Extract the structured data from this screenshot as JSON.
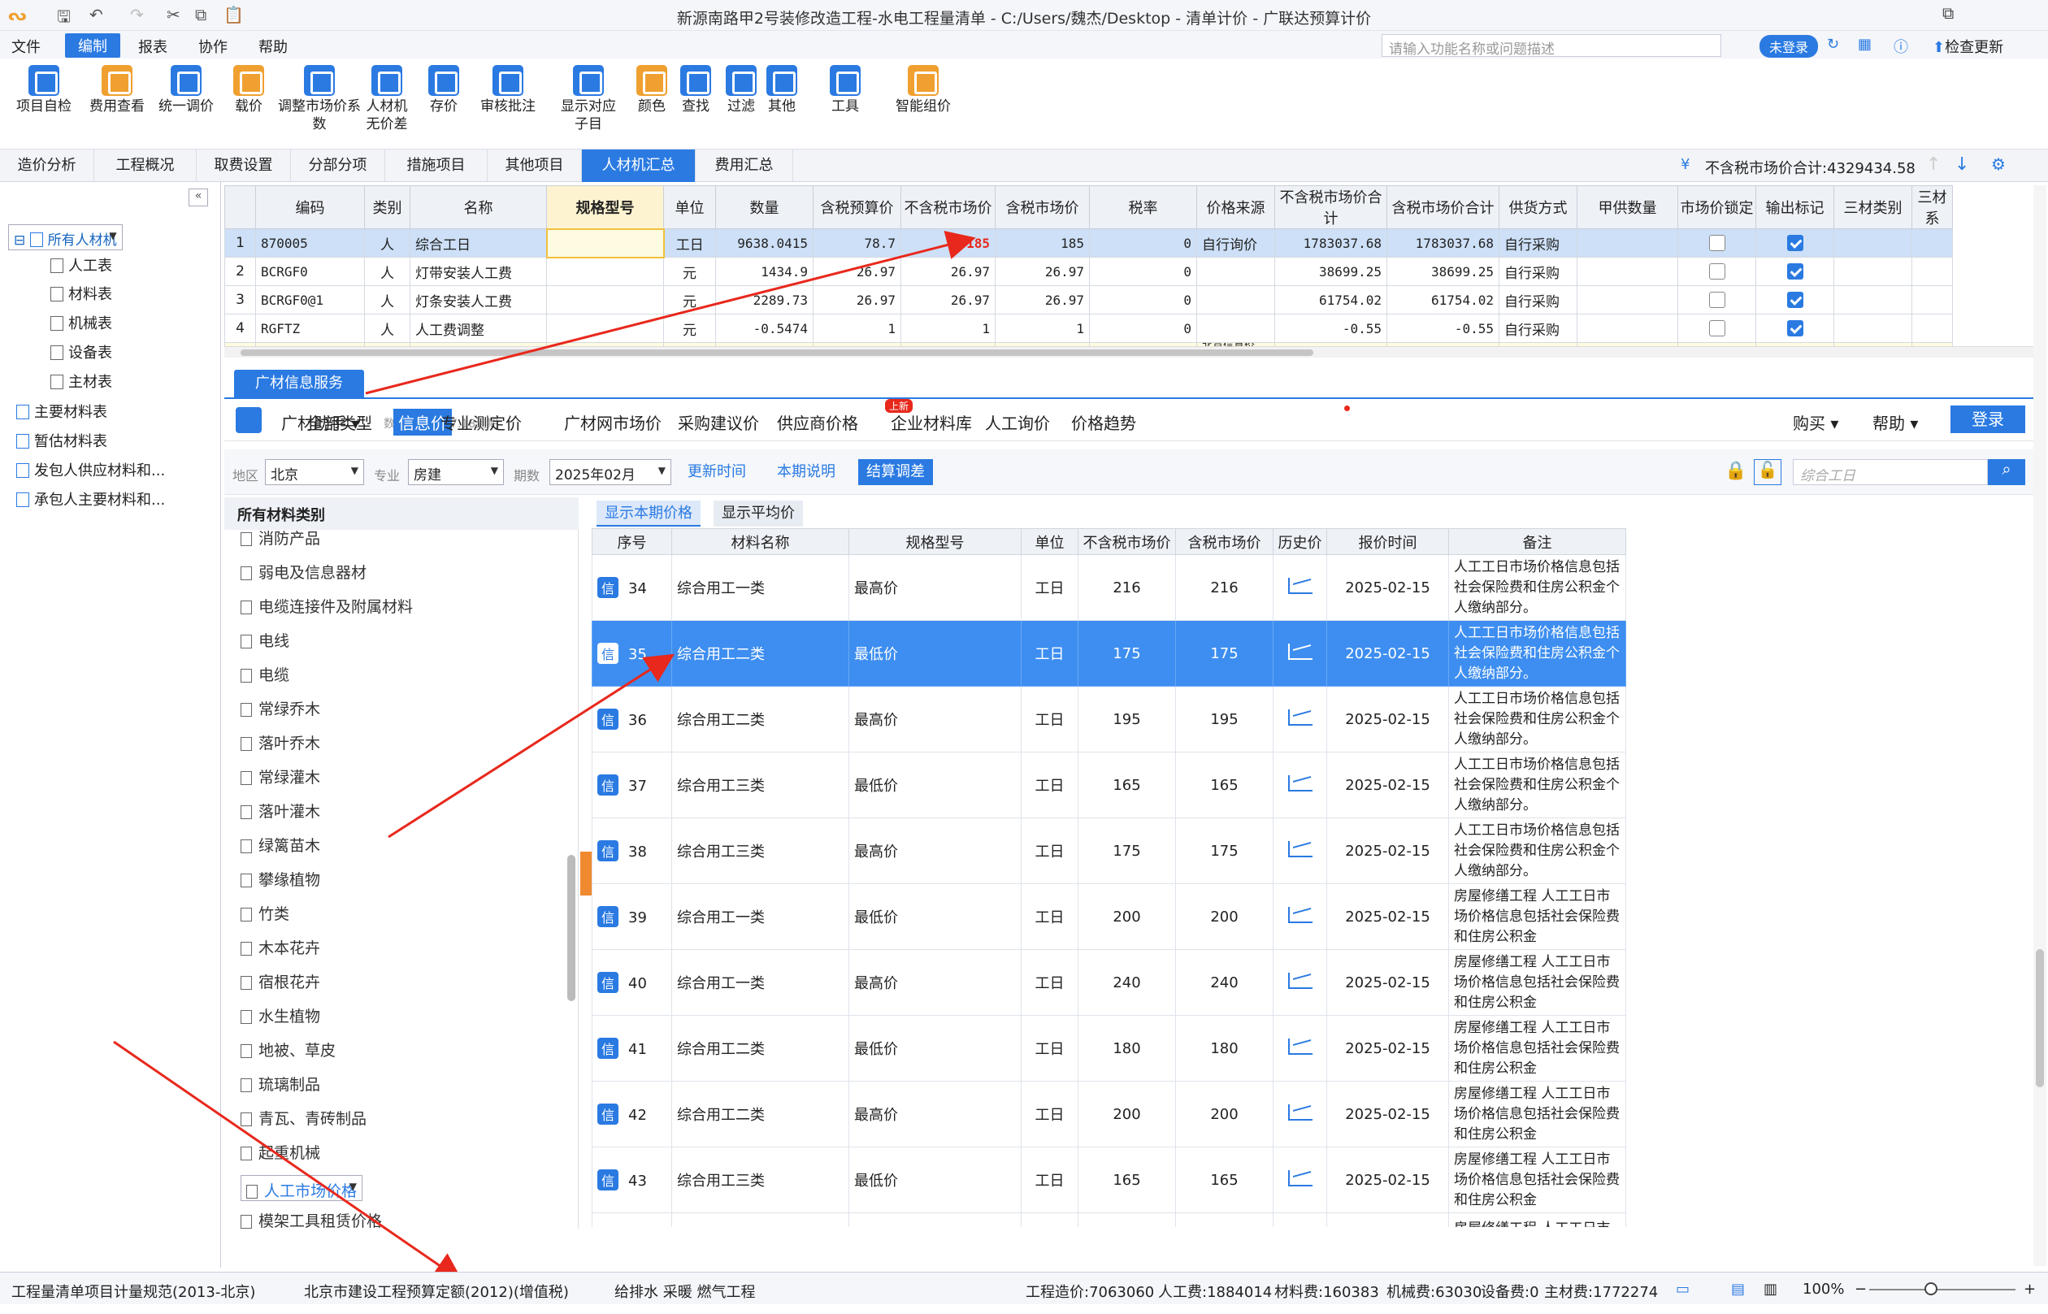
{
  "app": {
    "title": "新源南路甲2号装修改造工程-水电工程量清单 - C:/Users/魏杰/Desktop - 清单计价 - 广联达预算计价"
  },
  "menubar": {
    "items": [
      "文件",
      "编制",
      "报表",
      "协作",
      "帮助"
    ],
    "active": "编制",
    "search_placeholder": "请输入功能名称或问题描述",
    "login": "未登录",
    "update": "检查更新"
  },
  "ribbon": [
    {
      "label": "项目自检",
      "color": "#2a7ae2"
    },
    {
      "label": "费用查看",
      "color": "#f0a030"
    },
    {
      "label": "统一调价",
      "color": "#2a7ae2"
    },
    {
      "label": "载价",
      "color": "#f0a030"
    },
    {
      "label": "调整市场价系数",
      "color": "#2a7ae2"
    },
    {
      "label": "人材机无价差",
      "color": "#2a7ae2"
    },
    {
      "label": "存价",
      "color": "#2a7ae2"
    },
    {
      "label": "审核批注",
      "color": "#2a7ae2"
    },
    {
      "label": "显示对应子目",
      "color": "#2a7ae2"
    },
    {
      "label": "颜色",
      "color": "#f0a030"
    },
    {
      "label": "查找",
      "color": "#2a7ae2"
    },
    {
      "label": "过滤",
      "color": "#2a7ae2"
    },
    {
      "label": "其他",
      "color": "#2a7ae2"
    },
    {
      "label": "工具",
      "color": "#2a7ae2"
    },
    {
      "label": "智能组价",
      "color": "#f0a030"
    }
  ],
  "tabs": [
    "造价分析",
    "工程概况",
    "取费设置",
    "分部分项",
    "措施项目",
    "其他项目",
    "人材机汇总",
    "费用汇总"
  ],
  "active_tab": "人材机汇总",
  "total_label": "不含税市场价合计:4329434.58",
  "tree": [
    {
      "label": "所有人材机",
      "level": 0,
      "selected": true
    },
    {
      "label": "人工表",
      "level": 2
    },
    {
      "label": "材料表",
      "level": 2
    },
    {
      "label": "机械表",
      "level": 2
    },
    {
      "label": "设备表",
      "level": 2
    },
    {
      "label": "主材表",
      "level": 2
    },
    {
      "label": "主要材料表",
      "level": 0
    },
    {
      "label": "暂估材料表",
      "level": 0
    },
    {
      "label": "发包人供应材料和...",
      "level": 0
    },
    {
      "label": "承包人主要材料和...",
      "level": 0
    }
  ],
  "grid": {
    "columns": [
      "",
      "编码",
      "类别",
      "名称",
      "规格型号",
      "单位",
      "数量",
      "含税预算价",
      "不含税市场价",
      "含税市场价",
      "税率",
      "价格来源",
      "不含税市场价合计",
      "含税市场价合计",
      "供货方式",
      "甲供数量",
      "市场价锁定",
      "输出标记",
      "三材类别",
      "三材系"
    ],
    "rows": [
      [
        "1",
        "870005",
        "人",
        "综合工日",
        "",
        "工日",
        "9638.0415",
        "78.7",
        "185",
        "185",
        "0",
        "自行询价",
        "1783037.68",
        "1783037.68",
        "自行采购",
        "",
        false,
        true,
        "",
        ""
      ],
      [
        "2",
        "BCRGF0",
        "人",
        "灯带安装人工费",
        "",
        "元",
        "1434.9",
        "26.97",
        "26.97",
        "26.97",
        "0",
        "",
        "38699.25",
        "38699.25",
        "自行采购",
        "",
        false,
        true,
        "",
        ""
      ],
      [
        "3",
        "BCRGF0@1",
        "人",
        "灯条安装人工费",
        "",
        "元",
        "2289.73",
        "26.97",
        "26.97",
        "26.97",
        "0",
        "",
        "61754.02",
        "61754.02",
        "自行采购",
        "",
        false,
        true,
        "",
        ""
      ],
      [
        "4",
        "RGFTZ",
        "人",
        "人工费调整",
        "",
        "元",
        "-0.5474",
        "1",
        "1",
        "1",
        "0",
        "",
        "-0.55",
        "-0.55",
        "自行采购",
        "",
        false,
        true,
        "",
        ""
      ]
    ],
    "partial_row_text": "北京信息价"
  },
  "gc": {
    "tab": "广材信息服务",
    "assistant": "广材助手",
    "version": "数据包2044.7.18到期",
    "nav": [
      "全部类型",
      "信息价",
      "专业测定价",
      "广材网市场价",
      "采购建议价",
      "供应商价格",
      "企业材料库",
      "人工询价",
      "价格趋势"
    ],
    "nav_active": "信息价",
    "new_badge": "上新",
    "buy": "购买",
    "help": "帮助",
    "login": "登录",
    "filters": {
      "region_label": "地区",
      "region": "北京",
      "major_label": "专业",
      "major": "房建",
      "period_label": "期数",
      "period": "2025年02月"
    },
    "buttons": [
      "更新时间",
      "本期说明",
      "结算调差"
    ],
    "search_placeholder": "综合工日"
  },
  "categories": {
    "header": "所有材料类别",
    "items": [
      "消防产品",
      "弱电及信息器材",
      "电缆连接件及附属材料",
      "电线",
      "电缆",
      "常绿乔木",
      "落叶乔木",
      "常绿灌木",
      "落叶灌木",
      "绿篱苗木",
      "攀缘植物",
      "竹类",
      "木本花卉",
      "宿根花卉",
      "水生植物",
      "地被、草皮",
      "琉璃制品",
      "青瓦、青砖制品",
      "起重机械",
      "人工市场价格",
      "模架工具租赁价格"
    ],
    "selected": "人工市场价格"
  },
  "price": {
    "tabs": [
      "显示本期价格",
      "显示平均价"
    ],
    "columns": [
      "序号",
      "材料名称",
      "规格型号",
      "单位",
      "不含税市场价",
      "含税市场价",
      "历史价",
      "报价时间",
      "备注"
    ],
    "tag": "信",
    "rows": [
      {
        "no": "34",
        "name": "综合用工一类",
        "spec": "最高价",
        "unit": "工日",
        "ex": "216",
        "inc": "216",
        "date": "2025-02-15",
        "note": "人工工日市场价格信息包括社会保险费和住房公积金个人缴纳部分。"
      },
      {
        "no": "35",
        "name": "综合用工二类",
        "spec": "最低价",
        "unit": "工日",
        "ex": "175",
        "inc": "175",
        "date": "2025-02-15",
        "note": "人工工日市场价格信息包括社会保险费和住房公积金个人缴纳部分。",
        "hl": true
      },
      {
        "no": "36",
        "name": "综合用工二类",
        "spec": "最高价",
        "unit": "工日",
        "ex": "195",
        "inc": "195",
        "date": "2025-02-15",
        "note": "人工工日市场价格信息包括社会保险费和住房公积金个人缴纳部分。"
      },
      {
        "no": "37",
        "name": "综合用工三类",
        "spec": "最低价",
        "unit": "工日",
        "ex": "165",
        "inc": "165",
        "date": "2025-02-15",
        "note": "人工工日市场价格信息包括社会保险费和住房公积金个人缴纳部分。"
      },
      {
        "no": "38",
        "name": "综合用工三类",
        "spec": "最高价",
        "unit": "工日",
        "ex": "175",
        "inc": "175",
        "date": "2025-02-15",
        "note": "人工工日市场价格信息包括社会保险费和住房公积金个人缴纳部分。"
      },
      {
        "no": "39",
        "name": "综合用工一类",
        "spec": "最低价",
        "unit": "工日",
        "ex": "200",
        "inc": "200",
        "date": "2025-02-15",
        "note": "房屋修缮工程 人工工日市场价格信息包括社会保险费和住房公积金"
      },
      {
        "no": "40",
        "name": "综合用工一类",
        "spec": "最高价",
        "unit": "工日",
        "ex": "240",
        "inc": "240",
        "date": "2025-02-15",
        "note": "房屋修缮工程 人工工日市场价格信息包括社会保险费和住房公积金"
      },
      {
        "no": "41",
        "name": "综合用工二类",
        "spec": "最低价",
        "unit": "工日",
        "ex": "180",
        "inc": "180",
        "date": "2025-02-15",
        "note": "房屋修缮工程 人工工日市场价格信息包括社会保险费和住房公积金"
      },
      {
        "no": "42",
        "name": "综合用工二类",
        "spec": "最高价",
        "unit": "工日",
        "ex": "200",
        "inc": "200",
        "date": "2025-02-15",
        "note": "房屋修缮工程 人工工日市场价格信息包括社会保险费和住房公积金"
      },
      {
        "no": "43",
        "name": "综合用工三类",
        "spec": "最低价",
        "unit": "工日",
        "ex": "165",
        "inc": "165",
        "date": "2025-02-15",
        "note": "房屋修缮工程 人工工日市场价格信息包括社会保险费和住房公积金"
      }
    ],
    "partial_note": "房屋修缮工程 人工工日市"
  },
  "status": {
    "items": [
      "工程量清单项目计量规范(2013-北京)",
      "北京市建设工程预算定额(2012)(增值税)",
      "给排水 采暖 燃气工程",
      "工程造价:7063060",
      "人工费:1884014",
      "材料费:160383",
      "机械费:63030",
      "设备费:0",
      "主材费:1772274"
    ],
    "zoom": "100%"
  },
  "colors": {
    "accent": "#2a7ae2",
    "highlight_row": "#3d8ef0",
    "annotation_arrow": "#e8281c",
    "red_value": "#e8281c"
  }
}
